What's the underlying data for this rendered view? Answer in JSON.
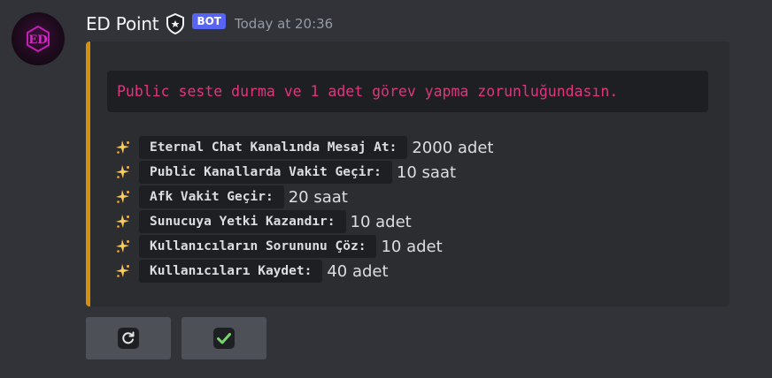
{
  "message": {
    "author": "ED Point",
    "bot_tag": "BOT",
    "timestamp": "Today at 20:36",
    "avatar_icon": "ed-logo-icon",
    "accent_color": "#d68e0e"
  },
  "embed": {
    "code_text": "Public seste durma ve 1 adet görev yapma zorunluğundasın.",
    "tasks": [
      {
        "name": "Eternal Chat Kanalında Mesaj At:",
        "value": "2000 adet",
        "icon": "sparkles-icon"
      },
      {
        "name": "Public Kanallarda Vakit Geçir:",
        "value": "10 saat",
        "icon": "sparkles-icon"
      },
      {
        "name": "Afk Vakit Geçir:",
        "value": "20 saat",
        "icon": "sparkles-icon"
      },
      {
        "name": "Sunucuya Yetki Kazandır:",
        "value": "10 adet",
        "icon": "sparkles-icon"
      },
      {
        "name": "Kullanıcıların Sorununu Çöz:",
        "value": "10 adet",
        "icon": "sparkles-icon"
      },
      {
        "name": "Kullanıcıları Kaydet:",
        "value": "40 adet",
        "icon": "sparkles-icon"
      }
    ]
  },
  "buttons": [
    {
      "icon": "refresh-icon"
    },
    {
      "icon": "check-icon"
    }
  ]
}
